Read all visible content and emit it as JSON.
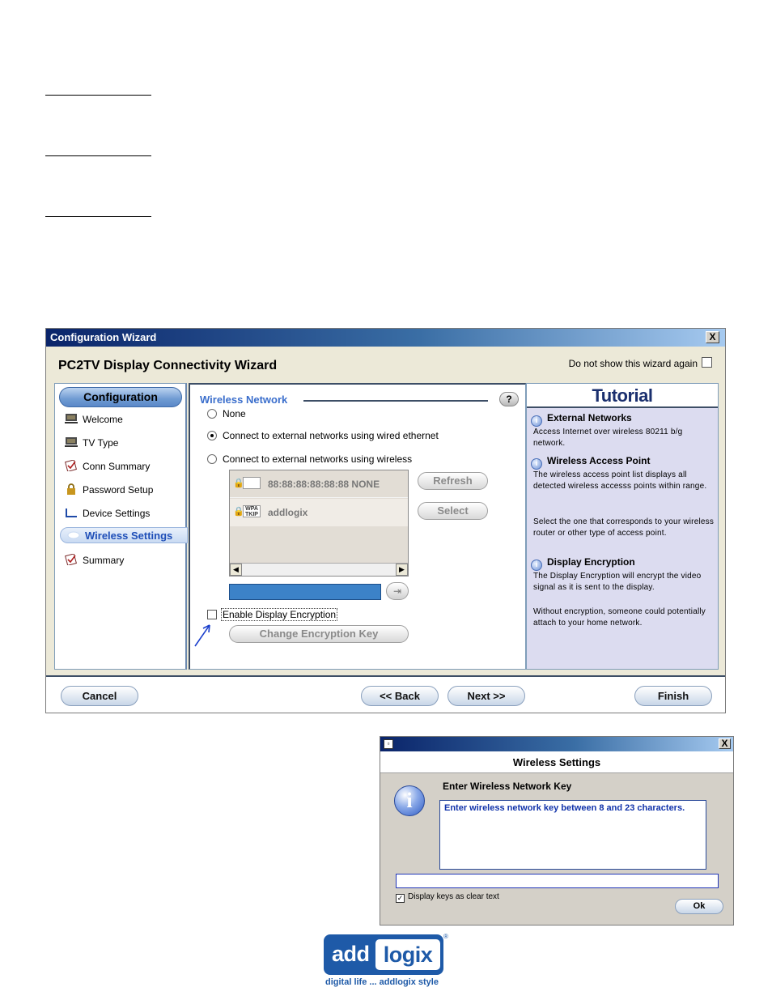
{
  "wizard": {
    "window_title": "Configuration Wizard",
    "close_label": "X",
    "heading": "PC2TV Display Connectivity Wizard",
    "dont_show_label": "Do not show this wizard again",
    "dont_show_checked": false,
    "nav": {
      "header": "Configuration",
      "items": [
        {
          "label": "Welcome",
          "icon": "monitor-icon"
        },
        {
          "label": "TV Type",
          "icon": "monitor-icon"
        },
        {
          "label": "Conn Summary",
          "icon": "checklist-icon"
        },
        {
          "label": "Password Setup",
          "icon": "lock-icon"
        },
        {
          "label": "Device Settings",
          "icon": "device-icon"
        },
        {
          "label": "Wireless Settings",
          "icon": "wireless-icon",
          "active": true
        },
        {
          "label": "Summary",
          "icon": "checklist-icon"
        }
      ]
    },
    "content": {
      "section_title": "Wireless Network",
      "help_label": "?",
      "options": [
        {
          "label": "None",
          "selected": false
        },
        {
          "label": "Connect to external networks using wired ethernet",
          "selected": true
        },
        {
          "label": "Connect to external networks using wireless",
          "selected": false
        }
      ],
      "access_points": [
        {
          "security": "lock",
          "badge": "",
          "text": "88:88:88:88:88:88  NONE"
        },
        {
          "security": "lock",
          "badge": "WPA TKIP",
          "text": "addlogix"
        }
      ],
      "refresh_label": "Refresh",
      "select_label": "Select",
      "scroll_left": "◀",
      "scroll_right": "▶",
      "encryption_label": "Enable Display Encryption",
      "encryption_checked": false,
      "change_key_label": "Change Encryption Key"
    },
    "tutorial": {
      "title": "Tutorial",
      "sections": [
        {
          "heading": "External Networks",
          "body": "Access Internet over wireless 80211 b/g network."
        },
        {
          "heading": "Wireless Access Point",
          "body": "The wireless access point list displays all detected wireless accesss points within range.",
          "body2": "Select the one that corresponds to your wireless router or other type of access point."
        },
        {
          "heading": "Display Encryption",
          "body": "The Display Encryption will encrypt the video signal as it is sent to the display.",
          "body2": "Without encryption, someone could potentially attach to your home network."
        }
      ]
    },
    "footer": {
      "cancel": "Cancel",
      "back": "<< Back",
      "next": "Next >>",
      "finish": "Finish"
    }
  },
  "dialog": {
    "close_label": "X",
    "title": "Wireless Settings",
    "prompt": "Enter Wireless Network Key",
    "message": "Enter wireless network key between 8 and 23 characters.",
    "key_value": "",
    "clear_text_label": "Display keys as clear text",
    "clear_text_checked": true,
    "ok_label": "Ok"
  },
  "logo": {
    "word1": "add",
    "word2": "logix",
    "registered": "®",
    "tagline": "digital life ... addlogix style",
    "brand_color": "#1e5aa8"
  },
  "colors": {
    "titlebar_start": "#0a246a",
    "section_title": "#3a6ecc",
    "nav_active_text": "#1f4fb8",
    "tutorial_bg": "#dcdcf0",
    "key_bar": "#3c82c8"
  }
}
